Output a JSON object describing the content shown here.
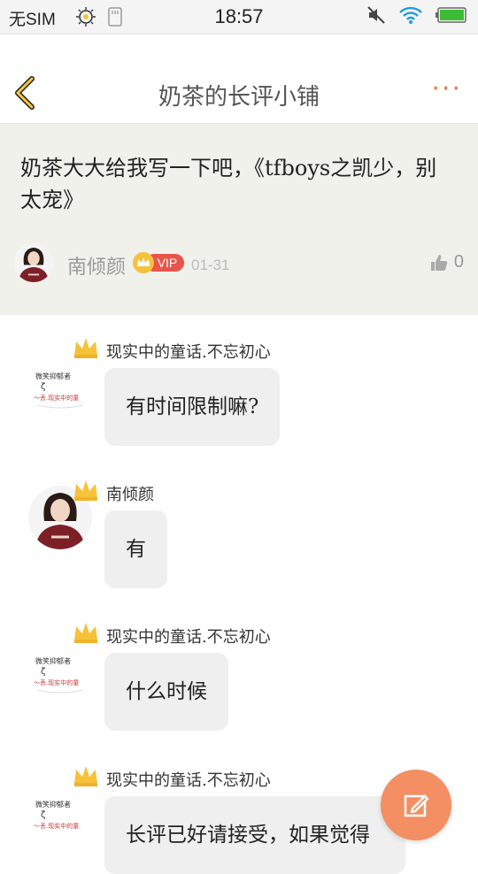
{
  "status_bar": {
    "carrier": "无SIM",
    "time": "18:57"
  },
  "header": {
    "title": "奶茶的长评小铺",
    "more_label": "···"
  },
  "question": {
    "text": "奶茶大大给我写一下吧，《tfboys之凯少，别太宠》",
    "author": "南倾颜",
    "vip_label": "VIP",
    "date": "01-31",
    "likes": "0"
  },
  "messages": [
    {
      "name": "现实中的童话.不忘初心",
      "text": "有时间限制嘛?",
      "avatar": "text-avatar"
    },
    {
      "name": "南倾颜",
      "text": "有",
      "avatar": "photo-avatar"
    },
    {
      "name": "现实中的童话.不忘初心",
      "text": "什么时候",
      "avatar": "text-avatar"
    },
    {
      "name": "现实中的童话.不忘初心",
      "text": "长评已好请接受，如果觉得",
      "avatar": "text-avatar"
    }
  ],
  "colors": {
    "accent": "#f07b3f",
    "fab": "#f38f62",
    "question_bg": "#f1f1ec",
    "bubble_bg": "#efefef",
    "crown": "#f6c23a"
  },
  "icons": {
    "back": "chevron-left-icon",
    "more": "more-icon",
    "like": "thumbs-up-icon",
    "compose": "edit-icon",
    "crown": "crown-icon"
  }
}
